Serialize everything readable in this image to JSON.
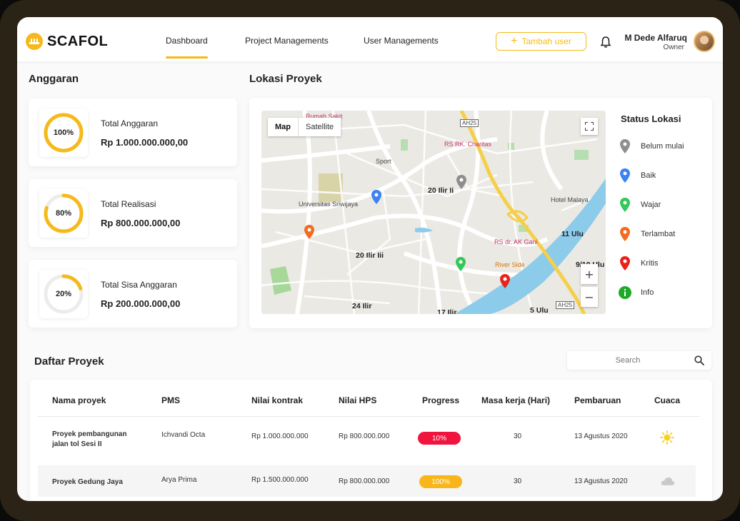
{
  "app": {
    "brand": "SCAFOL"
  },
  "nav": {
    "dashboard": "Dashboard",
    "projects": "Project Managements",
    "users": "User Managements"
  },
  "header": {
    "add_user": "Tambah user"
  },
  "user": {
    "name": "M Dede Alfaruq",
    "role": "Owner"
  },
  "budget": {
    "title": "Anggaran",
    "cards": [
      {
        "percent_label": "100%",
        "percent": 100,
        "title": "Total Anggaran",
        "value": "Rp 1.000.000.000,00"
      },
      {
        "percent_label": "80%",
        "percent": 80,
        "title": "Total Realisasi",
        "value": "Rp 800.000.000,00"
      },
      {
        "percent_label": "20%",
        "percent": 20,
        "title": "Total Sisa Anggaran",
        "value": "Rp 200.000.000,00"
      }
    ]
  },
  "map": {
    "title": "Lokasi Proyek",
    "tabs": [
      "Map",
      "Satellite"
    ],
    "labels": {
      "rumah_sakit": "Rumah Sakit",
      "ah25_top": "AH25",
      "rs_charitas": "RS RK. Charitas",
      "sport": "Sport",
      "ilir20": "20 Ilir Ii",
      "universitas": "Universitas Sriwijaya",
      "hotel": "Hotel Malaya",
      "ulu11": "11 Ulu",
      "rs_ak_gani": "RS dr. AK Gani",
      "ilir20iii": "20 Ilir Iii",
      "river_side": "River Side",
      "ulu9": "9/10 Ulu",
      "ilir24": "24 Ilir",
      "ilir17": "17 Ilir",
      "ulu5": "5 Ulu",
      "ah25_bottom": "AH25"
    }
  },
  "legend": {
    "title": "Status Lokasi",
    "items": [
      {
        "label": "Belum mulai",
        "color": "#8e8e8e"
      },
      {
        "label": "Baik",
        "color": "#3b82f6"
      },
      {
        "label": "Wajar",
        "color": "#34c759"
      },
      {
        "label": "Terlambat",
        "color": "#f36b21"
      },
      {
        "label": "Kritis",
        "color": "#e8231b"
      },
      {
        "label": "Info",
        "color": "#1fa82a"
      }
    ]
  },
  "projects": {
    "title": "Daftar Proyek",
    "search_placeholder": "Search",
    "columns": [
      "Nama  proyek",
      "PMS",
      "Nilai kontrak",
      "Nilai HPS",
      "Progress",
      "Masa kerja (Hari)",
      "Pembaruan",
      "Cuaca"
    ],
    "rows": [
      {
        "name": "Proyek pembangunan jalan tol Sesi II",
        "pms": "Ichvandi Octa",
        "contract": "Rp 1.000.000.000",
        "hps": "Rp 800.000.000",
        "progress": "10%",
        "progress_color": "#f0153f",
        "days": "30",
        "updated": "13 Agustus 2020",
        "weather": "sun-icon"
      },
      {
        "name": "Proyek Gedung Jaya",
        "pms": "Arya Prima",
        "contract": "Rp 1.500.000.000",
        "hps": "Rp 800.000.000",
        "progress": "100%",
        "progress_color": "#f8b61b",
        "days": "30",
        "updated": "13 Agustus 2020",
        "weather": "cloud-icon"
      }
    ]
  },
  "colors": {
    "accent": "#f6b91a"
  }
}
